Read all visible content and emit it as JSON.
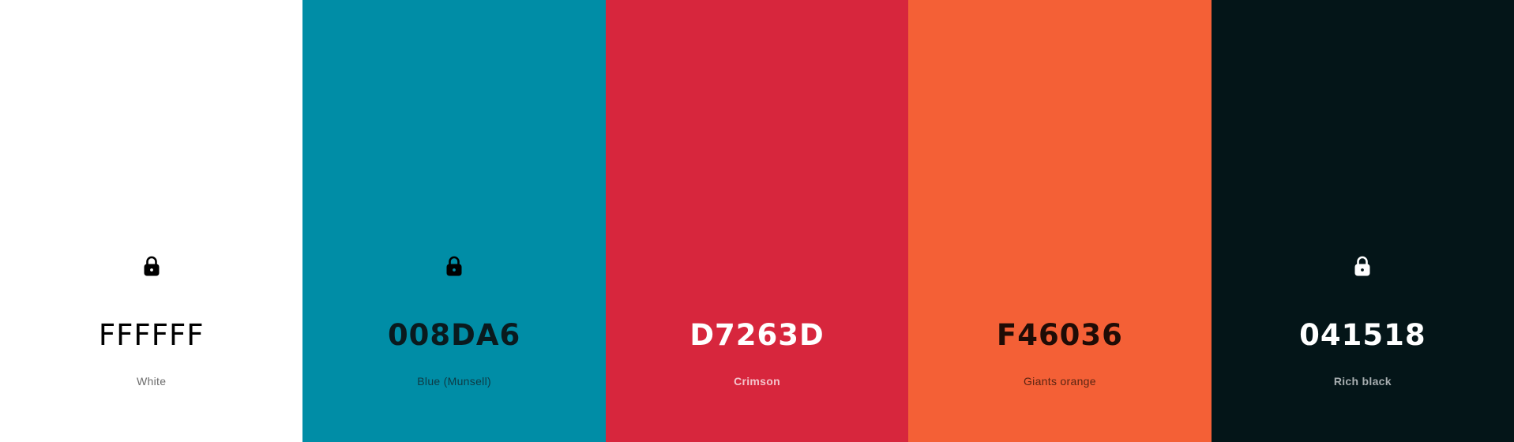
{
  "palette": {
    "swatches": [
      {
        "hex": "FFFFFF",
        "name": "White",
        "color": "#FFFFFF",
        "locked": true,
        "icon": "lock-icon",
        "icon_color": "#000000"
      },
      {
        "hex": "008DA6",
        "name": "Blue (Munsell)",
        "color": "#008DA6",
        "locked": true,
        "icon": "lock-icon",
        "icon_color": "#000000"
      },
      {
        "hex": "D7263D",
        "name": "Crimson",
        "color": "#D7263D",
        "locked": false
      },
      {
        "hex": "F46036",
        "name": "Giants orange",
        "color": "#F46036",
        "locked": false
      },
      {
        "hex": "041518",
        "name": "Rich black",
        "color": "#041518",
        "locked": true,
        "icon": "lock-icon",
        "icon_color": "#FFFFFF"
      }
    ]
  }
}
